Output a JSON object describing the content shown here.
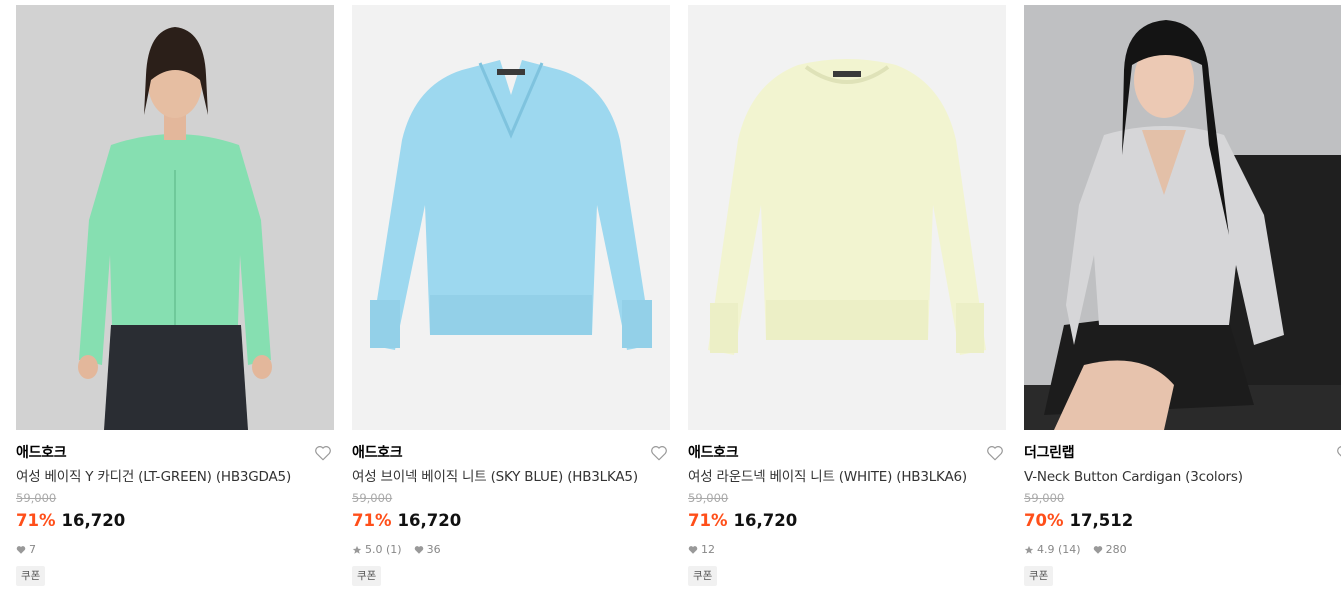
{
  "products": [
    {
      "brand": "애드호크",
      "name": "여성 베이직 Y 카디건 (LT-GREEN) (HB3GDA5)",
      "original_price": "59,000",
      "discount": "71%",
      "price": "16,720",
      "rating": "",
      "likes": "7",
      "coupon": "쿠폰",
      "image_desc": "model-green-cardigan",
      "colors": {
        "bg": "#cfcfcf",
        "garment": "#86dfb1"
      }
    },
    {
      "brand": "애드호크",
      "name": "여성 브이넥 베이직 니트 (SKY BLUE) (HB3LKA5)",
      "original_price": "59,000",
      "discount": "71%",
      "price": "16,720",
      "rating": "5.0 (1)",
      "likes": "36",
      "coupon": "쿠폰",
      "image_desc": "sky-blue-vneck-knit",
      "colors": {
        "bg": "#f2f2f2",
        "garment": "#9dd8ef"
      }
    },
    {
      "brand": "애드호크",
      "name": "여성 라운드넥 베이직 니트 (WHITE) (HB3LKA6)",
      "original_price": "59,000",
      "discount": "71%",
      "price": "16,720",
      "rating": "",
      "likes": "12",
      "coupon": "쿠폰",
      "image_desc": "cream-round-neck-knit",
      "colors": {
        "bg": "#f2f2f2",
        "garment": "#f2f4d0"
      }
    },
    {
      "brand": "더그린랩",
      "name": "V-Neck Button Cardigan (3colors)",
      "original_price": "59,000",
      "discount": "70%",
      "price": "17,512",
      "rating": "4.9 (14)",
      "likes": "280",
      "coupon": "쿠폰",
      "image_desc": "model-grey-cardigan",
      "colors": {
        "bg": "#2e2e2e",
        "garment": "#d6d6d8"
      }
    }
  ],
  "accent_color": "#ff4f1a"
}
